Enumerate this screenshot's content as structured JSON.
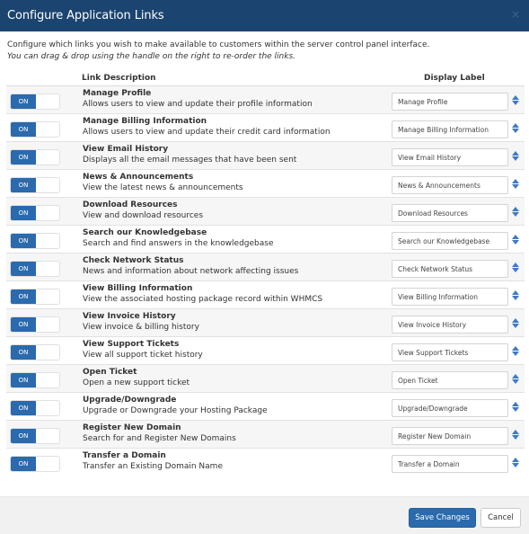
{
  "header": {
    "title": "Configure Application Links",
    "close_icon": "close-icon",
    "close_glyph": "×"
  },
  "intro": {
    "line1": "Configure which links you wish to make available to customers within the server control panel interface.",
    "line2": "You can drag & drop using the handle on the right to re-order the links."
  },
  "columns": {
    "description": "Link Description",
    "display_label": "Display Label"
  },
  "links": [
    {
      "toggle": "ON",
      "title": "Manage Profile",
      "description": "Allows users to view and update their profile information",
      "label": "Manage Profile"
    },
    {
      "toggle": "ON",
      "title": "Manage Billing Information",
      "description": "Allows users to view and update their credit card information",
      "label": "Manage Billing Information"
    },
    {
      "toggle": "ON",
      "title": "View Email History",
      "description": "Displays all the email messages that have been sent",
      "label": "View Email History"
    },
    {
      "toggle": "ON",
      "title": "News & Announcements",
      "description": "View the latest news & announcements",
      "label": "News & Announcements"
    },
    {
      "toggle": "ON",
      "title": "Download Resources",
      "description": "View and download resources",
      "label": "Download Resources"
    },
    {
      "toggle": "ON",
      "title": "Search our Knowledgebase",
      "description": "Search and find answers in the knowledgebase",
      "label": "Search our Knowledgebase"
    },
    {
      "toggle": "ON",
      "title": "Check Network Status",
      "description": "News and information about network affecting issues",
      "label": "Check Network Status"
    },
    {
      "toggle": "ON",
      "title": "View Billing Information",
      "description": "View the associated hosting package record within WHMCS",
      "label": "View Billing Information"
    },
    {
      "toggle": "ON",
      "title": "View Invoice History",
      "description": "View invoice & billing history",
      "label": "View Invoice History"
    },
    {
      "toggle": "ON",
      "title": "View Support Tickets",
      "description": "View all support ticket history",
      "label": "View Support Tickets"
    },
    {
      "toggle": "ON",
      "title": "Open Ticket",
      "description": "Open a new support ticket",
      "label": "Open Ticket"
    },
    {
      "toggle": "ON",
      "title": "Upgrade/Downgrade",
      "description": "Upgrade or Downgrade your Hosting Package",
      "label": "Upgrade/Downgrade"
    },
    {
      "toggle": "ON",
      "title": "Register New Domain",
      "description": "Search for and Register New Domains",
      "label": "Register New Domain"
    },
    {
      "toggle": "ON",
      "title": "Transfer a Domain",
      "description": "Transfer an Existing Domain Name",
      "label": "Transfer a Domain"
    }
  ],
  "footer": {
    "save_label": "Save Changes",
    "cancel_label": "Cancel"
  },
  "colors": {
    "header_bg": "#1b4470",
    "accent": "#2a6aad",
    "handle": "#3d7bc4"
  }
}
